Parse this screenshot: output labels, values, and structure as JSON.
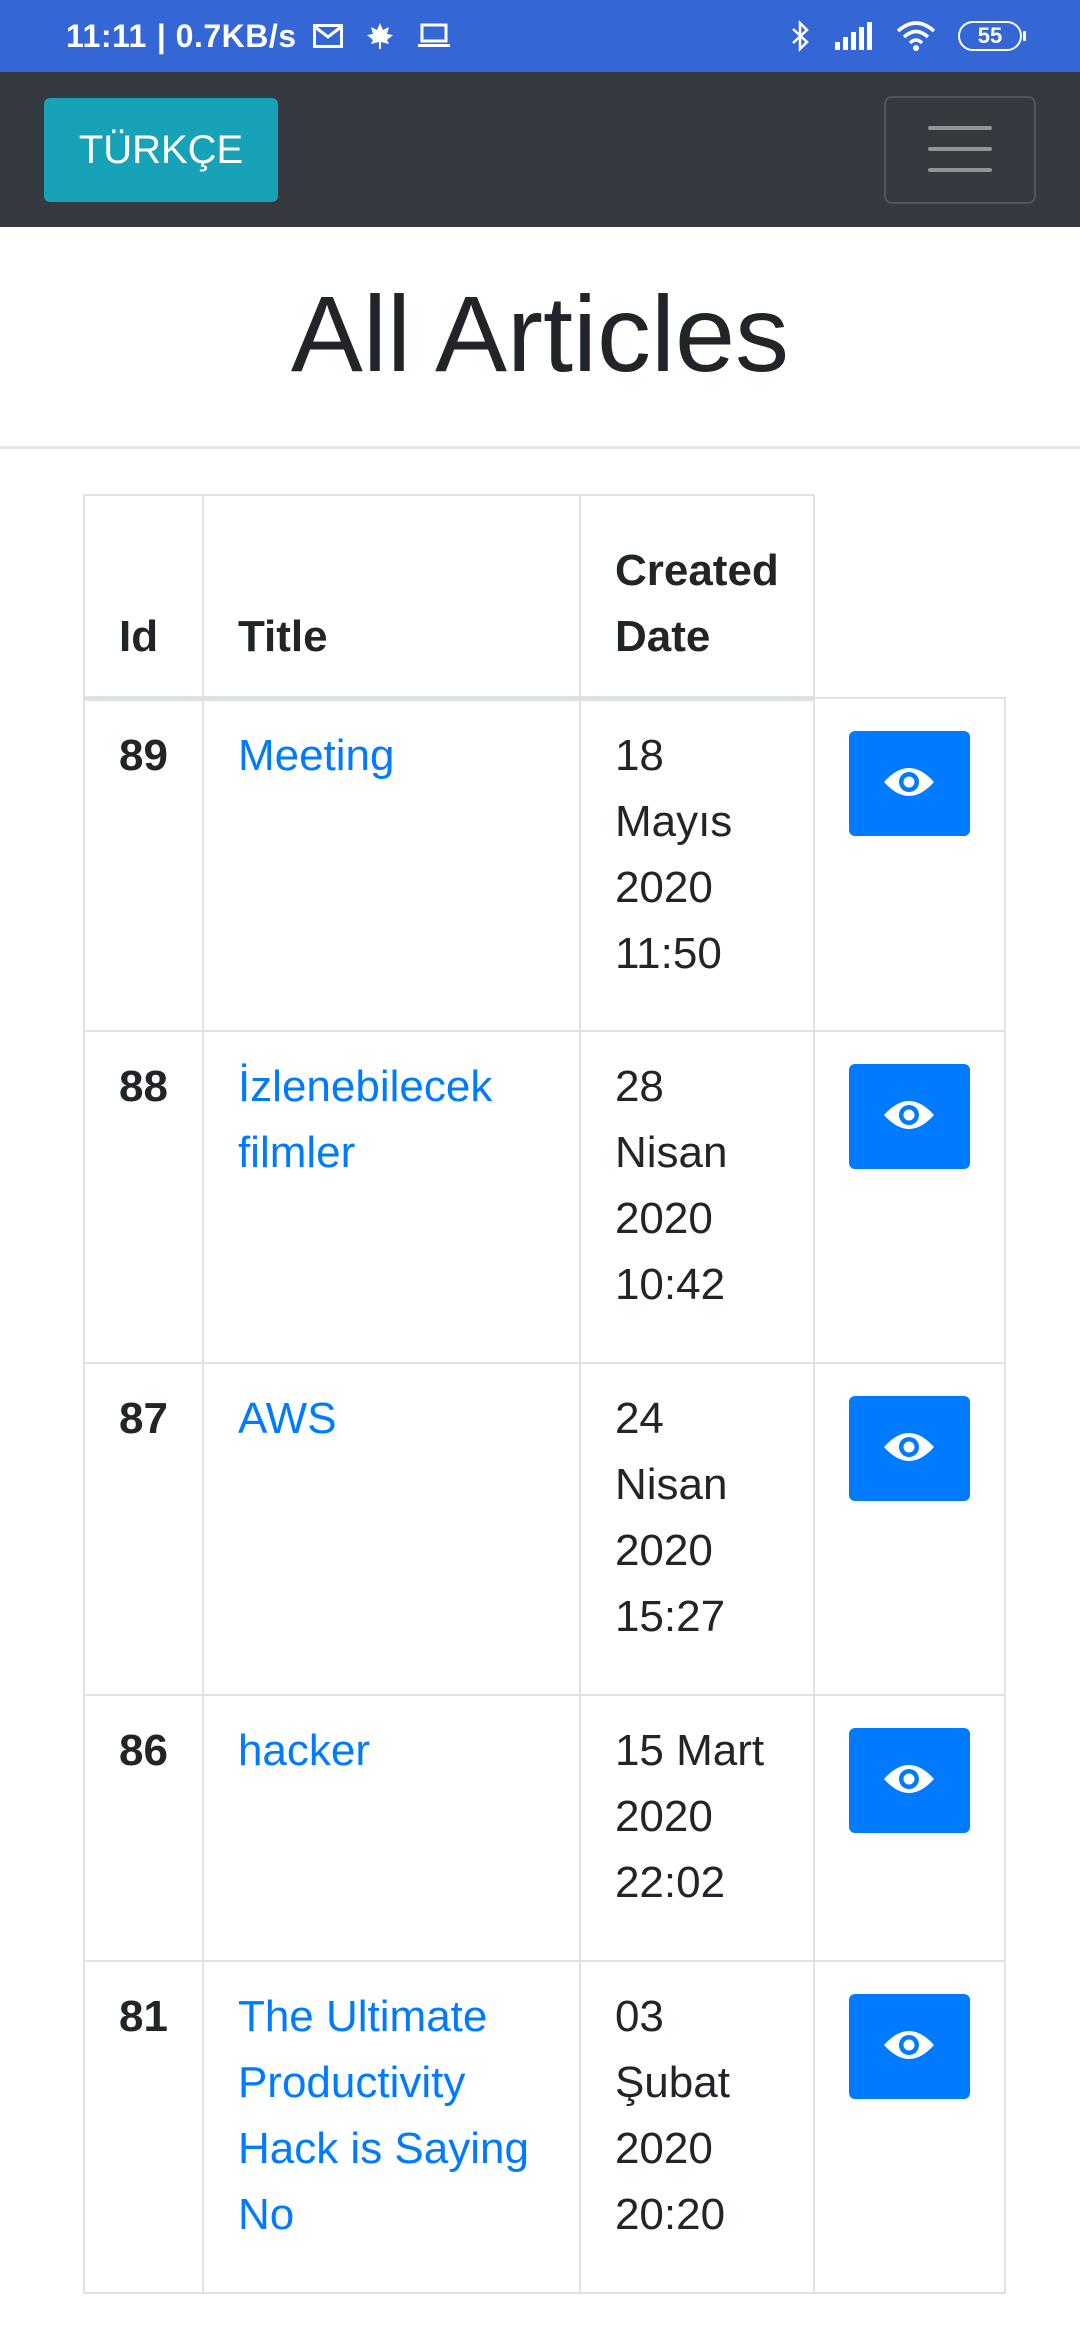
{
  "status_bar": {
    "time": "11:11",
    "network_speed": "| 0.7KB/s",
    "icons": [
      "mail-icon",
      "leaf-icon",
      "laptop-icon",
      "bluetooth-icon",
      "signal-icon",
      "wifi-icon"
    ],
    "battery": "55"
  },
  "navbar": {
    "language_button": "TÜRKÇE",
    "toggler_icon": "hamburger-menu-icon",
    "bg_color": "#343a40",
    "language_button_color": "#17a2b8"
  },
  "page": {
    "title": "All Articles"
  },
  "table": {
    "headers": {
      "id": "Id",
      "title": "Title",
      "created_line1": "Created",
      "created_line2": "Date"
    },
    "rows": [
      {
        "id": "89",
        "title_lines": [
          "Meeting"
        ],
        "date_lines": [
          "18",
          "Mayıs",
          "2020",
          "11:50"
        ]
      },
      {
        "id": "88",
        "title_lines": [
          "İzlenebilecek",
          "filmler"
        ],
        "date_lines": [
          "28",
          "Nisan",
          "2020",
          "10:42"
        ]
      },
      {
        "id": "87",
        "title_lines": [
          "AWS"
        ],
        "date_lines": [
          "24",
          "Nisan",
          "2020",
          "15:27"
        ]
      },
      {
        "id": "86",
        "title_lines": [
          "hacker"
        ],
        "date_lines": [
          "15 Mart",
          "2020",
          "22:02"
        ]
      },
      {
        "id": "81",
        "title_lines": [
          "The Ultimate",
          "Productivity",
          "Hack is Saying",
          "No"
        ],
        "date_lines": [
          "03",
          "Şubat",
          "2020",
          "20:20"
        ]
      }
    ],
    "view_icon": "eye-icon",
    "link_color": "#007bff",
    "view_button_color": "#007bff"
  }
}
